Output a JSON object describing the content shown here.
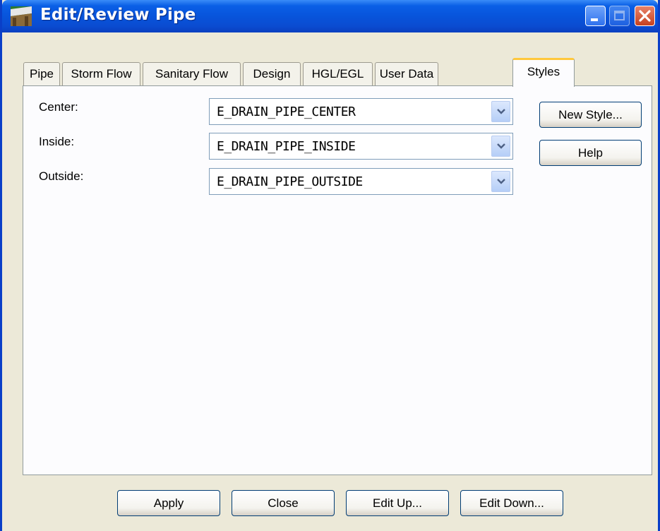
{
  "window": {
    "title": "Edit/Review Pipe",
    "icon": "pipe-app-icon",
    "controls": {
      "minimize": "minimize-icon",
      "maximize": "maximize-icon",
      "close": "close-icon"
    }
  },
  "tabs": [
    {
      "label": "Pipe"
    },
    {
      "label": "Storm Flow"
    },
    {
      "label": "Sanitary Flow"
    },
    {
      "label": "Design"
    },
    {
      "label": "HGL/EGL"
    },
    {
      "label": "User Data"
    },
    {
      "label": "Styles",
      "active": true
    }
  ],
  "styles": {
    "center": {
      "label": "Center:",
      "value": "E_DRAIN_PIPE_CENTER"
    },
    "inside": {
      "label": "Inside:",
      "value": "E_DRAIN_PIPE_INSIDE"
    },
    "outside": {
      "label": "Outside:",
      "value": "E_DRAIN_PIPE_OUTSIDE"
    }
  },
  "side_buttons": {
    "new_style": "New Style...",
    "help": "Help"
  },
  "footer": {
    "apply": "Apply",
    "close": "Close",
    "edit_up": "Edit Up...",
    "edit_down": "Edit Down..."
  },
  "colors": {
    "titlebar": "#0854DB",
    "active_tab_accent": "#FFC83C",
    "dialog_bg": "#ECE9D8"
  }
}
